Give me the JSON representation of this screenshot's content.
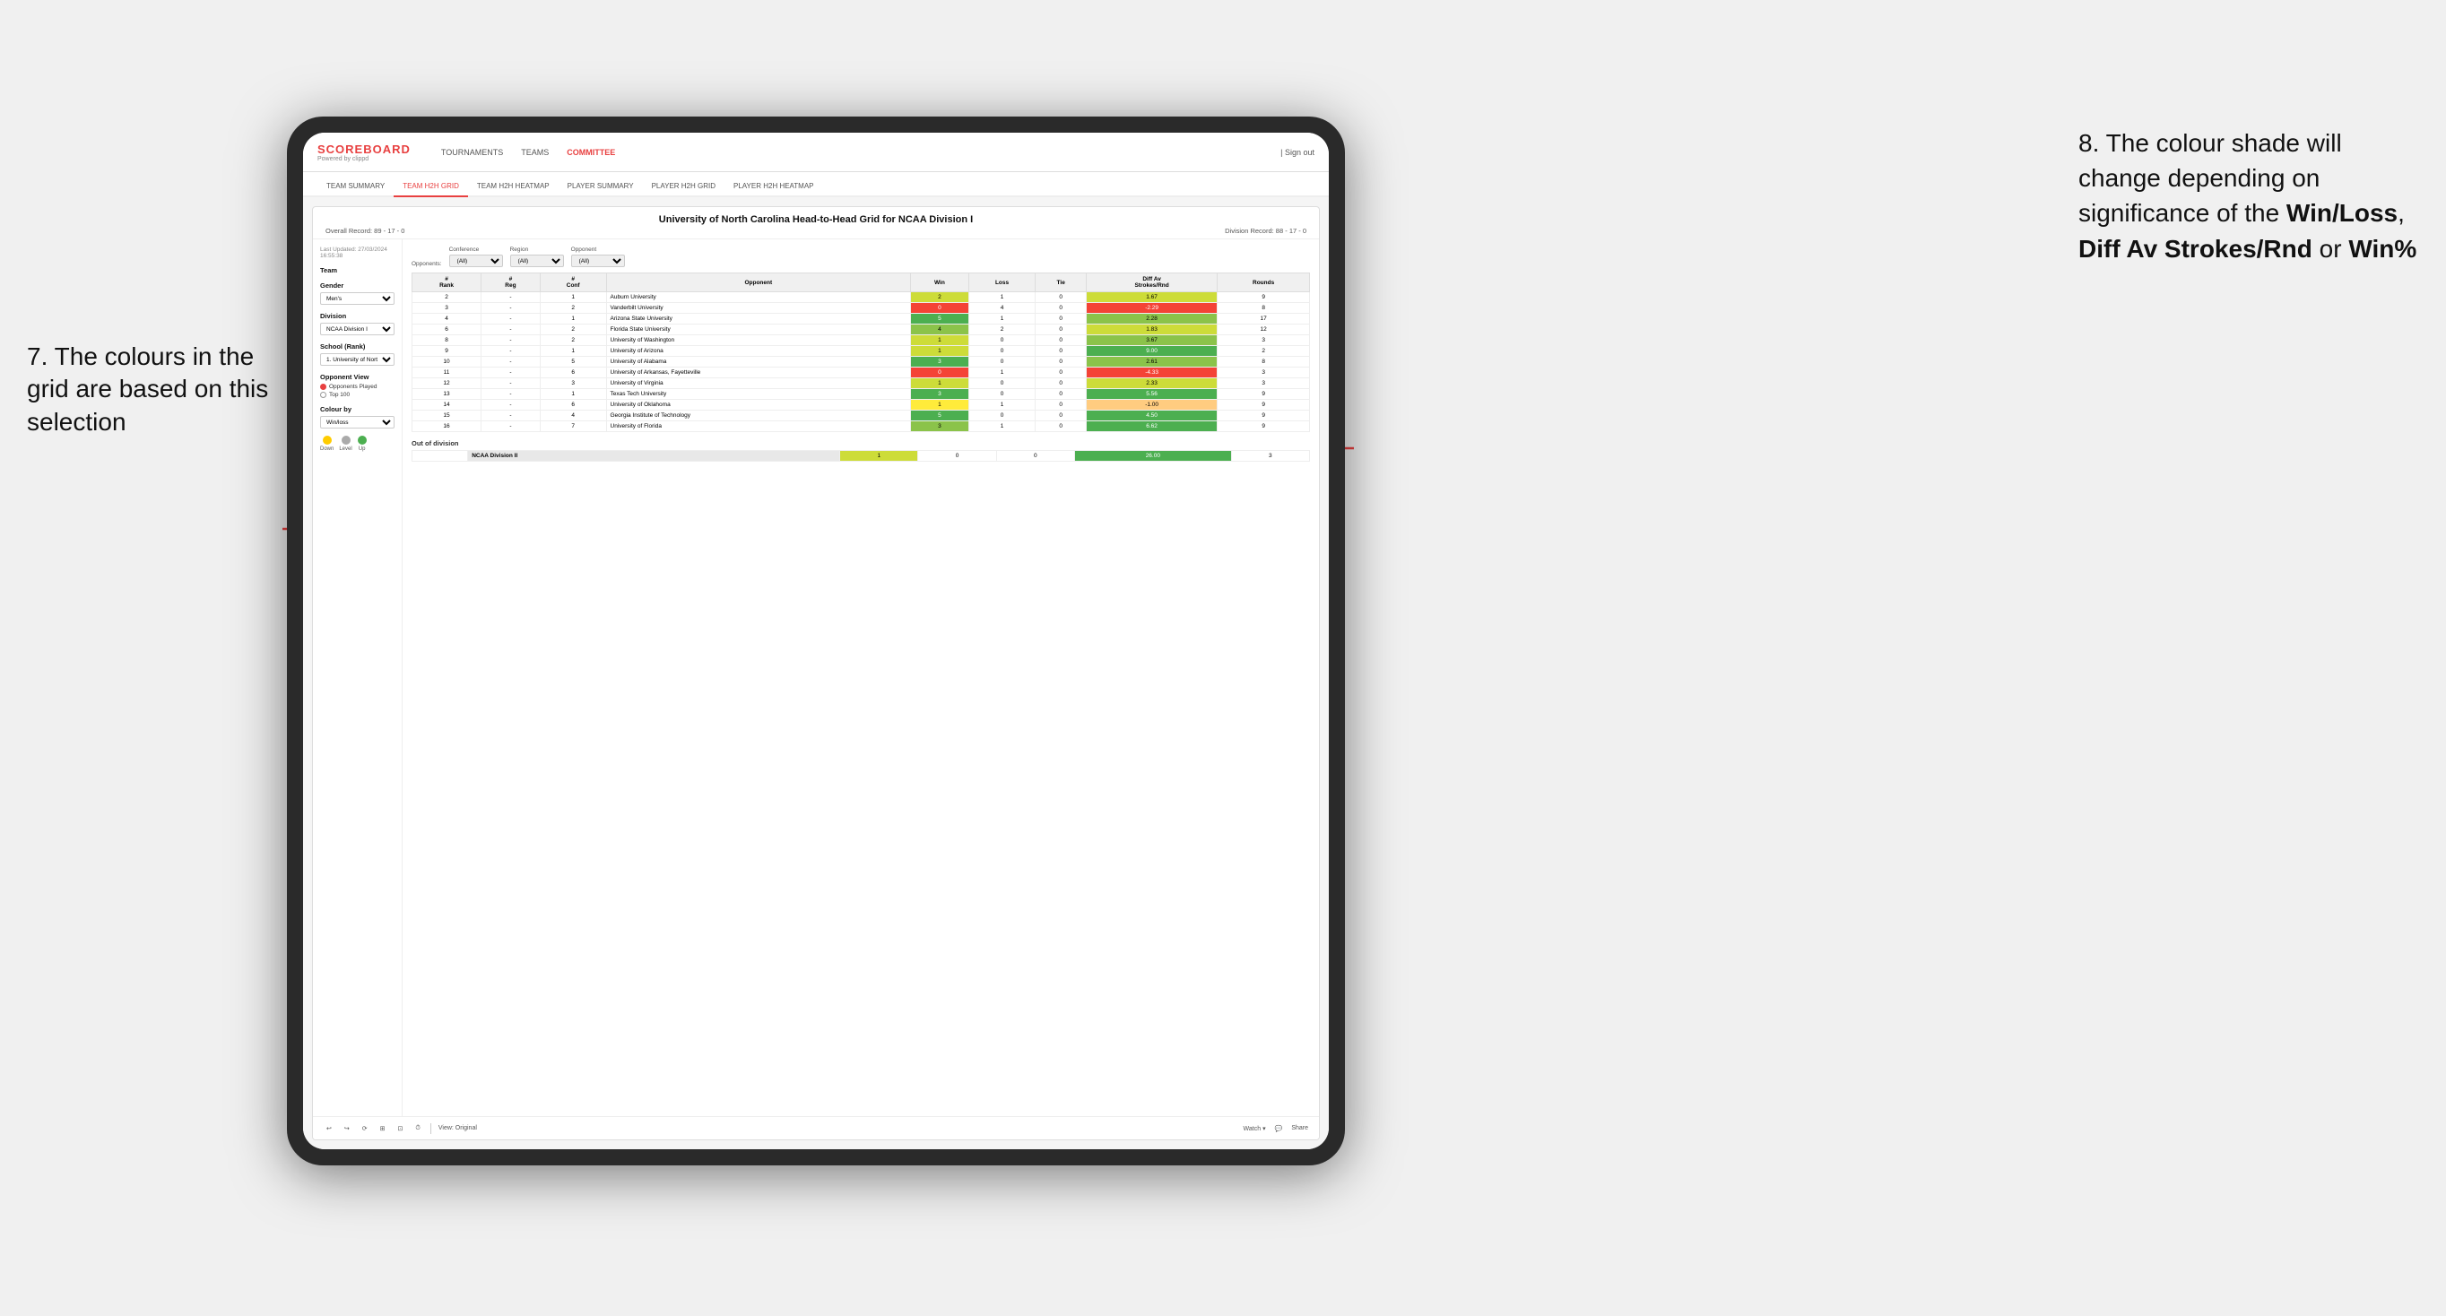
{
  "annotations": {
    "left": {
      "number": "7.",
      "text": "The colours in the grid are based on this selection"
    },
    "right": {
      "number": "8.",
      "text": "The colour shade will change depending on significance of the ",
      "bold1": "Win/Loss",
      "sep1": ", ",
      "bold2": "Diff Av Strokes/Rnd",
      "sep2": " or ",
      "bold3": "Win%"
    }
  },
  "nav": {
    "logo": "SCOREBOARD",
    "logo_sub": "Powered by clippd",
    "links": [
      "TOURNAMENTS",
      "TEAMS",
      "COMMITTEE"
    ],
    "active_link": "COMMITTEE",
    "sign_out": "| Sign out"
  },
  "sub_nav": {
    "items": [
      "TEAM SUMMARY",
      "TEAM H2H GRID",
      "TEAM H2H HEATMAP",
      "PLAYER SUMMARY",
      "PLAYER H2H GRID",
      "PLAYER H2H HEATMAP"
    ],
    "active": "TEAM H2H GRID"
  },
  "card": {
    "timestamp": "Last Updated: 27/03/2024 16:55:38",
    "title": "University of North Carolina Head-to-Head Grid for NCAA Division I",
    "overall_record": "Overall Record: 89 - 17 - 0",
    "division_record": "Division Record: 88 - 17 - 0",
    "left_panel": {
      "team_label": "Team",
      "gender_label": "Gender",
      "gender_value": "Men's",
      "division_label": "Division",
      "division_value": "NCAA Division I",
      "school_label": "School (Rank)",
      "school_value": "1. University of Nort...",
      "opponent_view_label": "Opponent View",
      "opponent_options": [
        "Opponents Played",
        "Top 100"
      ],
      "opponent_selected": "Opponents Played",
      "colour_by_label": "Colour by",
      "colour_by_value": "Win/loss",
      "legend": {
        "down_label": "Down",
        "level_label": "Level",
        "up_label": "Up",
        "down_color": "#ffcc00",
        "level_color": "#aaaaaa",
        "up_color": "#4caf50"
      }
    },
    "filters": {
      "opponents_label": "Opponents:",
      "opponents_value": "(All)",
      "conference_label": "Conference",
      "conference_value": "(All)",
      "region_label": "Region",
      "region_value": "(All)",
      "opponent_label": "Opponent",
      "opponent_value": "(All)"
    },
    "table": {
      "headers": [
        "#\nRank",
        "#\nReg",
        "#\nConf",
        "Opponent",
        "Win",
        "Loss",
        "Tie",
        "Diff Av\nStrokes/Rnd",
        "Rounds"
      ],
      "rows": [
        {
          "rank": "2",
          "reg": "-",
          "conf": "1",
          "opponent": "Auburn University",
          "win": "2",
          "loss": "1",
          "tie": "0",
          "diff": "1.67",
          "rounds": "9",
          "win_color": "green-light",
          "diff_color": "green-light"
        },
        {
          "rank": "3",
          "reg": "-",
          "conf": "2",
          "opponent": "Vanderbilt University",
          "win": "0",
          "loss": "4",
          "tie": "0",
          "diff": "-2.29",
          "rounds": "8",
          "win_color": "red",
          "diff_color": "red"
        },
        {
          "rank": "4",
          "reg": "-",
          "conf": "1",
          "opponent": "Arizona State University",
          "win": "5",
          "loss": "1",
          "tie": "0",
          "diff": "2.28",
          "rounds": "17",
          "win_color": "green-dark",
          "diff_color": "green-med"
        },
        {
          "rank": "6",
          "reg": "-",
          "conf": "2",
          "opponent": "Florida State University",
          "win": "4",
          "loss": "2",
          "tie": "0",
          "diff": "1.83",
          "rounds": "12",
          "win_color": "green-med",
          "diff_color": "green-light"
        },
        {
          "rank": "8",
          "reg": "-",
          "conf": "2",
          "opponent": "University of Washington",
          "win": "1",
          "loss": "0",
          "tie": "0",
          "diff": "3.67",
          "rounds": "3",
          "win_color": "green-light",
          "diff_color": "green-med"
        },
        {
          "rank": "9",
          "reg": "-",
          "conf": "1",
          "opponent": "University of Arizona",
          "win": "1",
          "loss": "0",
          "tie": "0",
          "diff": "9.00",
          "rounds": "2",
          "win_color": "green-light",
          "diff_color": "green-dark"
        },
        {
          "rank": "10",
          "reg": "-",
          "conf": "5",
          "opponent": "University of Alabama",
          "win": "3",
          "loss": "0",
          "tie": "0",
          "diff": "2.61",
          "rounds": "8",
          "win_color": "green-dark",
          "diff_color": "green-med"
        },
        {
          "rank": "11",
          "reg": "-",
          "conf": "6",
          "opponent": "University of Arkansas, Fayetteville",
          "win": "0",
          "loss": "1",
          "tie": "0",
          "diff": "-4.33",
          "rounds": "3",
          "win_color": "red",
          "diff_color": "red"
        },
        {
          "rank": "12",
          "reg": "-",
          "conf": "3",
          "opponent": "University of Virginia",
          "win": "1",
          "loss": "0",
          "tie": "0",
          "diff": "2.33",
          "rounds": "3",
          "win_color": "green-light",
          "diff_color": "green-light"
        },
        {
          "rank": "13",
          "reg": "-",
          "conf": "1",
          "opponent": "Texas Tech University",
          "win": "3",
          "loss": "0",
          "tie": "0",
          "diff": "5.56",
          "rounds": "9",
          "win_color": "green-dark",
          "diff_color": "green-dark"
        },
        {
          "rank": "14",
          "reg": "-",
          "conf": "6",
          "opponent": "University of Oklahoma",
          "win": "1",
          "loss": "1",
          "tie": "0",
          "diff": "-1.00",
          "rounds": "9",
          "win_color": "yellow",
          "diff_color": "orange-light"
        },
        {
          "rank": "15",
          "reg": "-",
          "conf": "4",
          "opponent": "Georgia Institute of Technology",
          "win": "5",
          "loss": "0",
          "tie": "0",
          "diff": "4.50",
          "rounds": "9",
          "win_color": "green-dark",
          "diff_color": "green-dark"
        },
        {
          "rank": "16",
          "reg": "-",
          "conf": "7",
          "opponent": "University of Florida",
          "win": "3",
          "loss": "1",
          "tie": "0",
          "diff": "6.62",
          "rounds": "9",
          "win_color": "green-med",
          "diff_color": "green-dark"
        }
      ],
      "out_of_division": {
        "label": "Out of division",
        "row": {
          "division": "NCAA Division II",
          "win": "1",
          "loss": "0",
          "tie": "0",
          "diff": "26.00",
          "rounds": "3",
          "win_color": "green-light",
          "diff_color": "green-dark"
        }
      }
    },
    "toolbar": {
      "buttons": [
        "↩",
        "↪",
        "⟳",
        "⊞",
        "⊡",
        "⏱"
      ],
      "view_label": "View: Original",
      "watch": "Watch ▾",
      "comment": "💬",
      "share": "Share"
    }
  }
}
